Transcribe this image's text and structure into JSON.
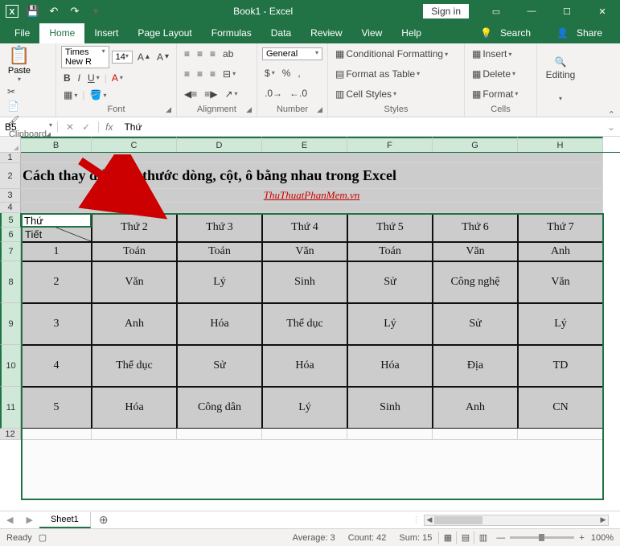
{
  "titlebar": {
    "title": "Book1 - Excel",
    "signin": "Sign in",
    "qat": {
      "save": "💾",
      "undo": "↶",
      "redo": "↷"
    }
  },
  "tabs": {
    "file": "File",
    "home": "Home",
    "insert": "Insert",
    "pagelayout": "Page Layout",
    "formulas": "Formulas",
    "data": "Data",
    "review": "Review",
    "view": "View",
    "help": "Help",
    "search": "Search",
    "share": "Share"
  },
  "ribbon": {
    "clipboard": {
      "label": "Clipboard",
      "paste": "Paste"
    },
    "font": {
      "label": "Font",
      "name": "Times New R",
      "size": "14"
    },
    "alignment": {
      "label": "Alignment"
    },
    "number": {
      "label": "Number",
      "format": "General"
    },
    "styles": {
      "label": "Styles",
      "cond": "Conditional Formatting",
      "table": "Format as Table",
      "cell": "Cell Styles"
    },
    "cells": {
      "label": "Cells",
      "insert": "Insert",
      "delete": "Delete",
      "format": "Format"
    },
    "editing": {
      "label": "Editing"
    }
  },
  "formulabar": {
    "namebox": "B5",
    "value": "Thứ"
  },
  "grid": {
    "cols": [
      "B",
      "C",
      "D",
      "E",
      "F",
      "G",
      "H"
    ],
    "row2_title": "Cách thay đổi kích thước dòng, cột, ô bằng nhau trong Excel",
    "row3_sub": "ThuThuatPhanMem.vn",
    "diag_top": "Thứ",
    "diag_bottom": "Tiết",
    "headers": [
      "Thứ 2",
      "Thứ 3",
      "Thứ 4",
      "Thứ 5",
      "Thứ 6",
      "Thứ 7"
    ],
    "rows": [
      {
        "n": "1",
        "cells": [
          "Toán",
          "Toán",
          "Văn",
          "Toán",
          "Văn",
          "Anh"
        ]
      },
      {
        "n": "2",
        "cells": [
          "Văn",
          "Lý",
          "Sinh",
          "Sử",
          "Công nghệ",
          "Văn"
        ]
      },
      {
        "n": "3",
        "cells": [
          "Anh",
          "Hóa",
          "Thể dục",
          "Lý",
          "Sử",
          "Lý"
        ]
      },
      {
        "n": "4",
        "cells": [
          "Thể dục",
          "Sử",
          "Hóa",
          "Hóa",
          "Địa",
          "TD"
        ]
      },
      {
        "n": "5",
        "cells": [
          "Hóa",
          "Công dân",
          "Lý",
          "Sinh",
          "Anh",
          "CN"
        ]
      }
    ],
    "row_heights": {
      "r1": 13,
      "r2": 32,
      "r3": 17,
      "r4": 13,
      "r56": 36,
      "r7": 24,
      "r811": 52,
      "r12": 14
    },
    "col_widths": {
      "B": 88,
      "C": 106,
      "D": 106,
      "E": 106,
      "F": 106,
      "G": 106,
      "H": 106
    }
  },
  "sheet": {
    "name": "Sheet1"
  },
  "status": {
    "ready": "Ready",
    "avg_label": "Average:",
    "avg_val": "3",
    "count_label": "Count:",
    "count_val": "42",
    "sum_label": "Sum:",
    "sum_val": "15",
    "zoom": "100%"
  }
}
